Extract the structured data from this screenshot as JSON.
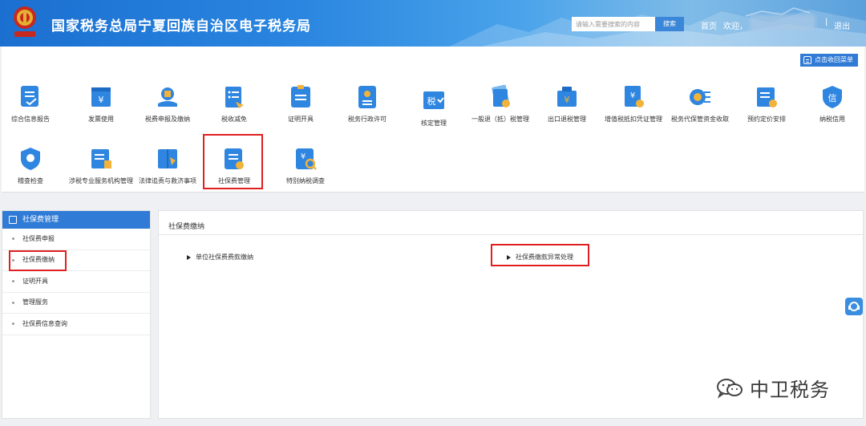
{
  "header": {
    "title": "国家税务总局宁夏回族自治区电子税务局",
    "search_placeholder": "请输入需要搜索的内容",
    "search_button": "搜索",
    "home": "首页",
    "welcome": "欢迎，",
    "separator": "|",
    "logout": "退出"
  },
  "panel": {
    "collapse_label": "点击收回菜单",
    "tiles": [
      {
        "label": "综合信息报告",
        "icon": "report-doc-icon"
      },
      {
        "label": "发票使用",
        "icon": "invoice-icon"
      },
      {
        "label": "税费申报及缴纳",
        "icon": "declare-pay-icon"
      },
      {
        "label": "税收减免",
        "icon": "tax-relief-icon"
      },
      {
        "label": "证明开具",
        "icon": "certificate-icon"
      },
      {
        "label": "税务行政许可",
        "icon": "license-icon"
      },
      {
        "label": "核定管理",
        "icon": "verify-tax-icon",
        "badge": "税"
      },
      {
        "label": "一般退（抵）税管理",
        "icon": "refund-icon"
      },
      {
        "label": "出口退税管理",
        "icon": "export-refund-icon"
      },
      {
        "label": "增值税抵扣凭证管理",
        "icon": "vat-voucher-icon"
      },
      {
        "label": "税务代保管资金收取",
        "icon": "custody-fund-icon"
      },
      {
        "label": "预约定价安排",
        "icon": "pricing-icon"
      },
      {
        "label": "纳税信用",
        "icon": "credit-shield-icon",
        "badge": "信"
      },
      {
        "label": "稽查检查",
        "icon": "inspection-icon"
      },
      {
        "label": "涉税专业服务机构管理",
        "icon": "agency-icon"
      },
      {
        "label": "法律追责与救济事项",
        "icon": "legal-book-icon"
      },
      {
        "label": "社保费管理",
        "icon": "social-security-icon"
      },
      {
        "label": "特别纳税调查",
        "icon": "investigation-icon"
      }
    ]
  },
  "sidebar": {
    "header": "社保费管理",
    "items": [
      "社保费申报",
      "社保费缴纳",
      "证明开具",
      "管理服务",
      "社保费信息查询"
    ]
  },
  "main": {
    "title": "社保费缴纳",
    "link_left": "单位社保费费款缴纳",
    "link_right": "社保费缴款异常处理"
  },
  "watermark": {
    "text": "中卫税务"
  },
  "colors": {
    "header_blue": "#2a86e0",
    "accent_blue": "#2f7bd6",
    "highlight_red": "#e02020"
  }
}
